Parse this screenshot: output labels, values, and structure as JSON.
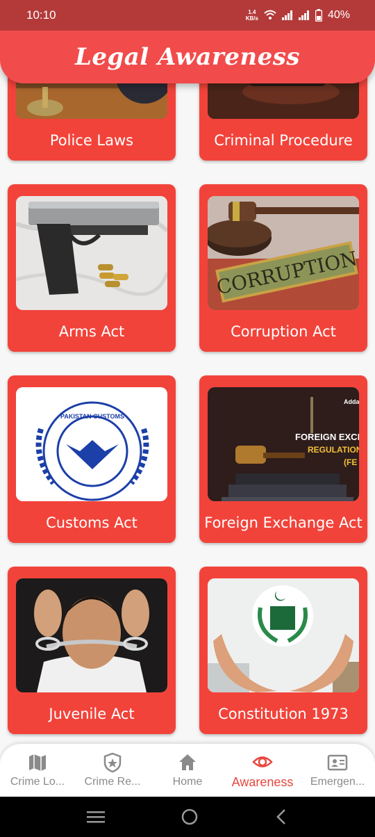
{
  "status_bar": {
    "time": "10:10",
    "net_speed_value": "1.4",
    "net_speed_unit": "KB/s",
    "battery": "40%"
  },
  "app_bar": {
    "title": "Legal Awareness"
  },
  "cards": [
    {
      "label": "Police Laws",
      "image": "police-laws-image"
    },
    {
      "label": "Criminal Procedure",
      "image": "criminal-procedure-image"
    },
    {
      "label": "Arms Act",
      "image": "pistol-image"
    },
    {
      "label": "Corruption Act",
      "image": "corruption-gavel-image",
      "image_text": "CORRUPTION"
    },
    {
      "label": "Customs Act",
      "image": "pakistan-customs-logo",
      "image_text": "PAKISTAN CUSTOMS"
    },
    {
      "label": "Foreign Exchange Act",
      "image": "foreign-exchange-image",
      "image_text_1": "Adda",
      "image_text_2": "FOREIGN EXCHAN",
      "image_text_3": "REGULATION A",
      "image_text_4": "(FE"
    },
    {
      "label": "Juvenile Act",
      "image": "handcuffed-boy-image"
    },
    {
      "label": "Constitution 1973",
      "image": "constitution-emblem-image"
    }
  ],
  "bottom_nav": [
    {
      "label": "Crime Lo...",
      "icon": "map-icon",
      "active": false
    },
    {
      "label": "Crime Re...",
      "icon": "badge-star-icon",
      "active": false
    },
    {
      "label": "Home",
      "icon": "home-icon",
      "active": false
    },
    {
      "label": "Awareness",
      "icon": "eye-icon",
      "active": true
    },
    {
      "label": "Emergen...",
      "icon": "contact-card-icon",
      "active": false
    }
  ],
  "colors": {
    "status_bar": "#b43a3a",
    "app_bar": "#f24b4b",
    "card": "#f2433a",
    "active_nav": "#e8473f",
    "inactive_nav": "#8a8a8a"
  }
}
